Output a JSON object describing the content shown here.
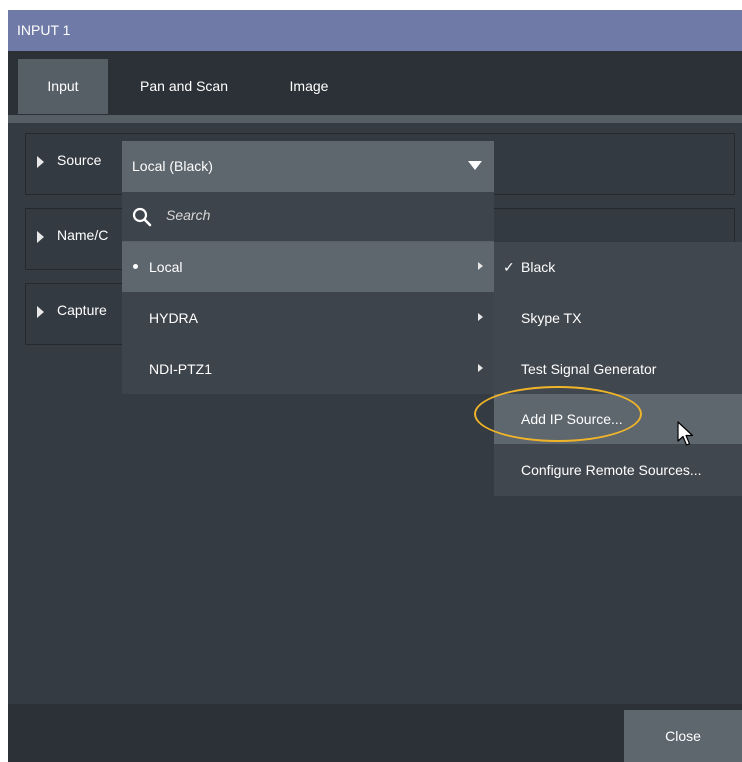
{
  "window": {
    "title": "INPUT 1"
  },
  "tabs": [
    {
      "label": "Input",
      "active": true
    },
    {
      "label": "Pan and Scan",
      "active": false
    },
    {
      "label": "Image",
      "active": false
    }
  ],
  "sections": [
    {
      "label": "Source"
    },
    {
      "label": "Name/C"
    },
    {
      "label": "Capture"
    }
  ],
  "source_select": {
    "value": "Local (Black)",
    "icon": "chevron-down-icon"
  },
  "search": {
    "placeholder": "Search",
    "icon": "search-icon"
  },
  "source_groups": [
    {
      "label": "Local",
      "selected": true
    },
    {
      "label": "HYDRA",
      "selected": false
    },
    {
      "label": "NDI-PTZ1",
      "selected": false
    }
  ],
  "submenu": [
    {
      "label": "Black",
      "checked": true
    },
    {
      "label": "Skype TX",
      "checked": false
    },
    {
      "label": "Test Signal Generator",
      "checked": false
    },
    {
      "label": "Add IP Source...",
      "hovered": true
    },
    {
      "label": "Configure Remote Sources..."
    }
  ],
  "footer": {
    "close_label": "Close"
  },
  "colors": {
    "title_bar": "#6f7aa6",
    "highlight_ring": "#f0b429",
    "panel": "#353b42"
  }
}
